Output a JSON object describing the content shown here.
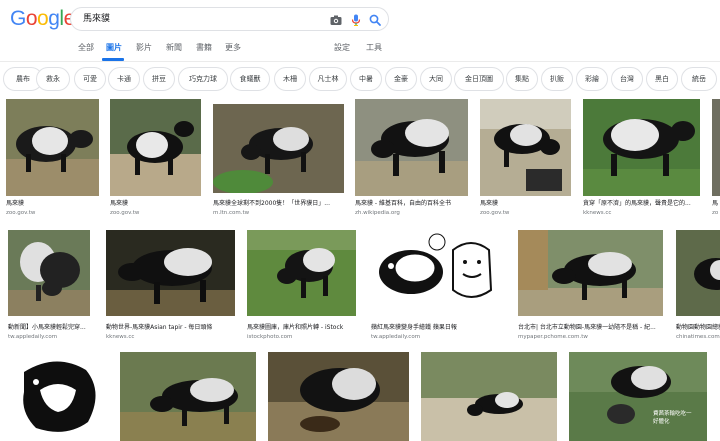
{
  "logo": {
    "letters": [
      "G",
      "o",
      "o",
      "g",
      "l",
      "e"
    ],
    "colors": [
      "#4285f4",
      "#ea4335",
      "#fbbc05",
      "#4285f4",
      "#34a853",
      "#ea4335"
    ]
  },
  "search": {
    "query": "馬來貘"
  },
  "icons": {
    "camera": "camera-icon",
    "mic": "mic-icon",
    "search": "search-icon"
  },
  "tabs": {
    "all": "全部",
    "images": "圖片",
    "videos": "影片",
    "news": "新聞",
    "books": "書籍",
    "more": "更多",
    "settings": "設定",
    "tools": "工具"
  },
  "chips": [
    "農布",
    "救永",
    "可愛",
    "卡通",
    "拼豆",
    "巧克力球",
    "食蟻獸",
    "木柵",
    "凡士林",
    "中暑",
    "金豪",
    "大同",
    "金日頂圖",
    "集點",
    "扒飯",
    "彩繪",
    "台灣",
    "黑白",
    "統岳"
  ],
  "results": {
    "r1": [
      {
        "caption": "馬來貘",
        "source": "zoo.gov.tw"
      },
      {
        "caption": "馬來貘",
        "source": "zoo.gov.tw"
      },
      {
        "caption": "馬來貘全球剩不到2000隻！「世界貘日」...",
        "source": "m.ltn.com.tw"
      },
      {
        "caption": "馬來貘 - 維基百科，自由的百科全书",
        "source": "zh.wikipedia.org"
      },
      {
        "caption": "馬來貘",
        "source": "zoo.gov.tw"
      },
      {
        "caption": "貪穿「原不濟」的馬來貘，聲貴是它的...",
        "source": "kknews.cc"
      },
      {
        "caption": "馬",
        "source": "zo"
      }
    ],
    "r2": [
      {
        "caption": "動新聞】小馬來貘輕鬆完穿...",
        "source": "tw.appledaily.com"
      },
      {
        "caption": "動物世界-馬來貘Asian tapir - 每日頭條",
        "source": "kknews.cc"
      },
      {
        "caption": "馬來貘圖庫，庫片和照片轉 - iStock",
        "source": "istockphoto.com"
      },
      {
        "caption": "蘋紅馬來貘變身手繪鐵 蘋果日報",
        "source": "tw.appledaily.com"
      },
      {
        "caption": "台北市| 台北市立動物園-馬來貘一幼隨不是稱 - 紀...",
        "source": "mypaper.pchome.com.tw"
      },
      {
        "caption": "動物園動物園總貘",
        "source": "chinatimes.com"
      }
    ],
    "r3_overlay": "費茜茶輸吃吃一\n好體化"
  }
}
